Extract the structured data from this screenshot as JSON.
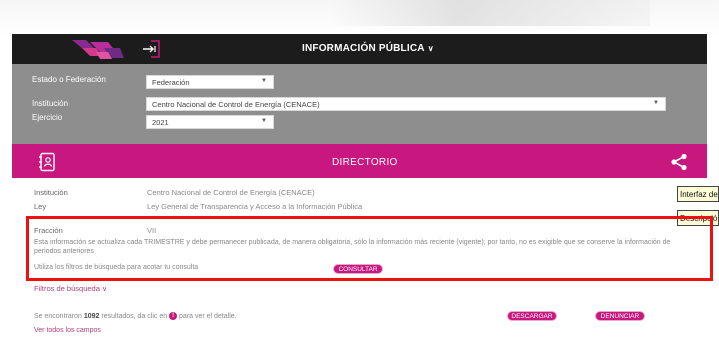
{
  "header": {
    "nav_title": "INFORMACIÓN PÚBLICA",
    "logo_icon": "transparency-logo-icon",
    "login_icon": "login-arrow-icon"
  },
  "filters": {
    "estado": {
      "label": "Estado o Federación",
      "value": "Federación"
    },
    "institucion": {
      "label": "Institución",
      "value": "Centro Nacional de Control de Energía (CENACE)"
    },
    "ejercicio": {
      "label": "Ejercicio",
      "value": "2021"
    }
  },
  "section": {
    "title": "DIRECTORIO",
    "icon": "directory-icon",
    "share_icon": "share-icon"
  },
  "tooltip": {
    "line1": "Interfaz de",
    "line2": "Descripció"
  },
  "details": {
    "institucion_label": "Institución",
    "institucion_value": "Centro Nacional de Control de Energía (CENACE)",
    "ley_label": "Ley",
    "ley_value": "Ley General de Transparencia y Acceso a la Información Pública",
    "fraccion_label": "Fracción",
    "fraccion_value": "VII"
  },
  "notice": {
    "text": "Esta información se actualiza cada TRIMESTRE y debe permanecer publicada, de manera obligatoria, sólo la información más reciente (vigente); por tanto, no es exigible que se conserve la información de periodos anteriores",
    "hint": "Utiliza los filtros de búsqueda para acotar tu consulta",
    "consultar": "CONSULTAR"
  },
  "search": {
    "filters_link": "Filtros de búsqueda",
    "results_prefix": "Se encontraron",
    "results_count": "1092",
    "results_middle": "resultados, da clic en",
    "results_suffix": "para ver el detalle.",
    "descargar": "DESCARGAR",
    "denunciar": "DENUNCIAR",
    "ver_todos": "Ver todos los campos"
  },
  "colors": {
    "brand_pink": "#c8177f",
    "header_dark": "#1c1c1c",
    "filter_gray": "#8e8e8e",
    "highlight_red": "#ee1111"
  }
}
